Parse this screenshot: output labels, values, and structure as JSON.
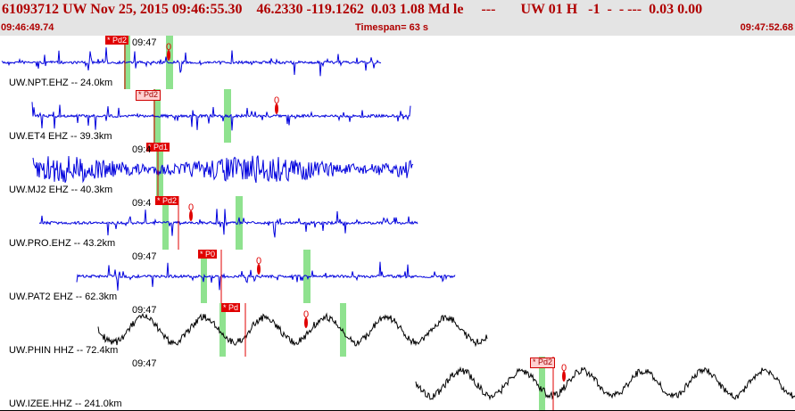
{
  "header": {
    "title": "61093712 UW Nov 25, 2015 09:46:55.30    46.2330 -119.1262  0.03 1.08 Md le     ---       UW 01 H   -1  -  - ---  0.03 0.00",
    "start_time": "09:46:49.74",
    "timespan": "Timespan=  63 s",
    "end_time": "09:47:52.68"
  },
  "colors": {
    "header_text": "#b00000",
    "trace_blue": "#0000dd",
    "trace_black": "#000000",
    "pick_red": "#e00000",
    "window_green": "#8fe28f"
  },
  "panels": [
    {
      "label": "UW.NPT.EHZ -- 24.0km",
      "time_mark": "09:47",
      "trace_color": "blue",
      "waveform": "noise",
      "pick_label": "* Pd2",
      "pick_style": "solid",
      "s_marker": "0"
    },
    {
      "label": "UW.ET4 EHZ -- 39.3km",
      "time_mark": "",
      "trace_color": "blue",
      "waveform": "noise",
      "pick_label": "* Pd2",
      "pick_style": "light",
      "s_marker": "0"
    },
    {
      "label": "UW.MJ2 EHZ -- 40.3km",
      "time_mark": "09:4",
      "trace_color": "blue",
      "waveform": "dense",
      "pick_label": "* Pd1",
      "pick_style": "solid",
      "s_marker": ""
    },
    {
      "label": "UW.PRO.EHZ -- 43.2km",
      "time_mark": "09:4",
      "trace_color": "blue",
      "waveform": "noise",
      "pick_label": "* Pd2",
      "pick_style": "solid",
      "s_marker": "0"
    },
    {
      "label": "UW.PAT2 EHZ -- 62.3km",
      "time_mark": "09:47",
      "trace_color": "blue",
      "waveform": "noise",
      "pick_label": "* P0",
      "pick_style": "solid",
      "s_marker": "0"
    },
    {
      "label": "UW.PHIN HHZ -- 72.4km",
      "time_mark": "09:47",
      "trace_color": "black",
      "waveform": "wave",
      "pick_label": "* Pd",
      "pick_style": "solid",
      "s_marker": "0"
    },
    {
      "label": "UW.IZEE.HHZ -- 241.0km",
      "time_mark": "09:47",
      "trace_color": "black",
      "waveform": "wave",
      "pick_label": "* Pd2",
      "pick_style": "light",
      "s_marker": "0"
    }
  ]
}
